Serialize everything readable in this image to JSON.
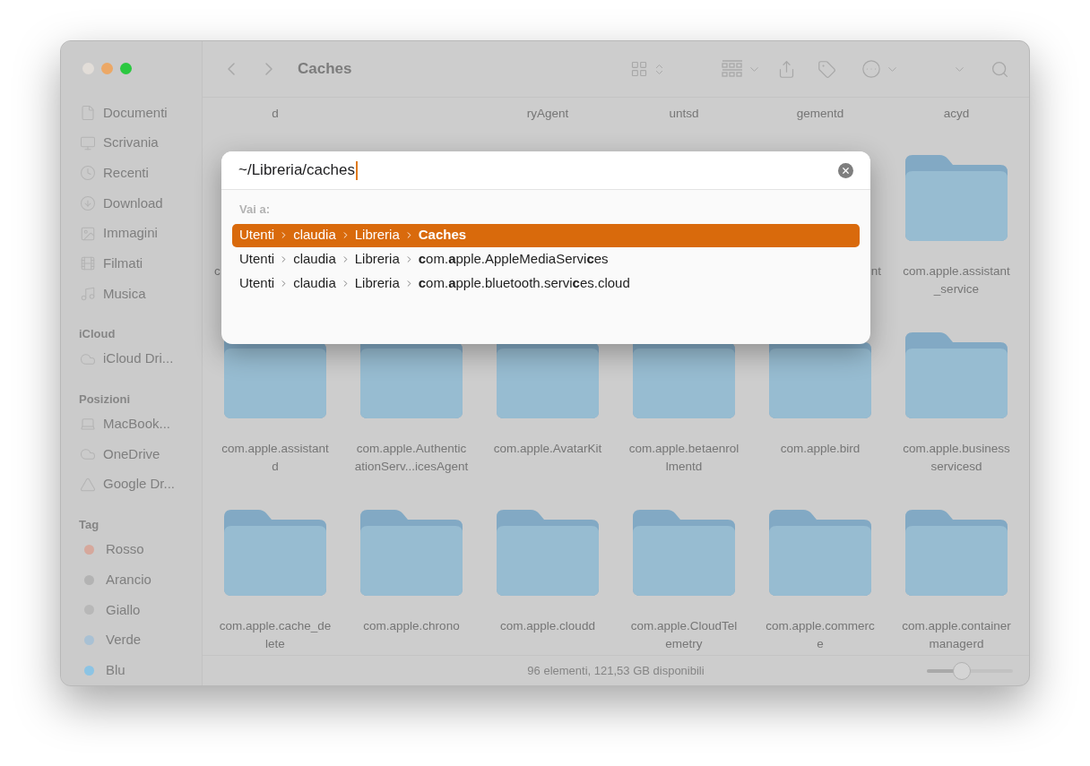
{
  "window": {
    "title": "Caches"
  },
  "sidebar": {
    "sections": [
      {
        "items": [
          {
            "label": "Documenti",
            "kind": "file"
          },
          {
            "label": "Scrivania",
            "kind": "desktop"
          },
          {
            "label": "Recenti",
            "kind": "clock"
          },
          {
            "label": "Download",
            "kind": "download"
          },
          {
            "label": "Immagini",
            "kind": "image"
          },
          {
            "label": "Filmati",
            "kind": "film"
          },
          {
            "label": "Musica",
            "kind": "music"
          }
        ]
      },
      {
        "title": "iCloud",
        "items": [
          {
            "label": "iCloud Dri...",
            "kind": "cloud"
          }
        ]
      },
      {
        "title": "Posizioni",
        "items": [
          {
            "label": "MacBook...",
            "kind": "laptop"
          },
          {
            "label": "OneDrive",
            "kind": "cloud"
          },
          {
            "label": "Google Dr...",
            "kind": "drive"
          }
        ]
      },
      {
        "title": "Tag",
        "items": [
          {
            "label": "Rosso",
            "kind": "tag",
            "color": "#d6a89c"
          },
          {
            "label": "Arancio",
            "kind": "tag",
            "color": "#b3b3b3"
          },
          {
            "label": "Giallo",
            "kind": "tag",
            "color": "#b8b8b8"
          },
          {
            "label": "Verde",
            "kind": "tag",
            "color": "#a9c1d4"
          },
          {
            "label": "Blu",
            "kind": "tag",
            "color": "#8cc4e4"
          }
        ]
      }
    ]
  },
  "grid": {
    "rows": [
      [
        {
          "kind": "tail",
          "lines": [
            "d"
          ]
        },
        {
          "kind": "hidden"
        },
        {
          "kind": "tail",
          "lines": [
            "ryAgent"
          ]
        },
        {
          "kind": "tail",
          "lines": [
            "untsd"
          ]
        },
        {
          "kind": "tail",
          "lines": [
            "gementd"
          ]
        },
        {
          "kind": "tail",
          "lines": [
            "acyd"
          ]
        }
      ],
      [
        {
          "kind": "clipped_left",
          "lines": [
            "c"
          ]
        },
        {
          "kind": "hidden"
        },
        {
          "kind": "hidden"
        },
        {
          "kind": "hidden"
        },
        {
          "kind": "clipped_right",
          "lines": [
            "nt"
          ]
        },
        {
          "kind": "folder",
          "lines": [
            "com.apple.assistant",
            "_service"
          ]
        }
      ],
      [
        {
          "kind": "folder",
          "lines": [
            "com.apple.assistant",
            "d"
          ]
        },
        {
          "kind": "folder",
          "lines": [
            "com.apple.Authentic",
            "ationServ...icesAgent"
          ]
        },
        {
          "kind": "folder",
          "lines": [
            "com.apple.AvatarKit"
          ]
        },
        {
          "kind": "folder",
          "lines": [
            "com.apple.betaenrol",
            "lmentd"
          ]
        },
        {
          "kind": "folder",
          "lines": [
            "com.apple.bird"
          ]
        },
        {
          "kind": "folder",
          "lines": [
            "com.apple.business",
            "servicesd"
          ]
        }
      ],
      [
        {
          "kind": "folder",
          "lines": [
            "com.apple.cache_de",
            "lete"
          ]
        },
        {
          "kind": "folder",
          "lines": [
            "com.apple.chrono"
          ]
        },
        {
          "kind": "folder",
          "lines": [
            "com.apple.cloudd"
          ]
        },
        {
          "kind": "folder",
          "lines": [
            "com.apple.CloudTel",
            "emetry"
          ]
        },
        {
          "kind": "folder",
          "lines": [
            "com.apple.commerc",
            "e"
          ]
        },
        {
          "kind": "folder",
          "lines": [
            "com.apple.container",
            "managerd"
          ]
        }
      ]
    ]
  },
  "status_bar": {
    "text": "96 elementi, 121,53 GB disponibili",
    "zoom": {
      "level": 0.41
    }
  },
  "goto_dialog": {
    "value": "~/Libreria/caches",
    "heading": "Vai a:",
    "suggestions": [
      {
        "selected": true,
        "path": [
          "Utenti",
          "claudia",
          "Libreria",
          "Caches"
        ]
      },
      {
        "selected": false,
        "path": [
          "Utenti",
          "claudia",
          "Libreria",
          "**c**om.**a**pple.AppleMediaServi**c**es"
        ]
      },
      {
        "selected": false,
        "path": [
          "Utenti",
          "claudia",
          "Libreria",
          "**c**om.**a**pple.bluetooth.servi**c**es.cloud"
        ]
      }
    ]
  }
}
